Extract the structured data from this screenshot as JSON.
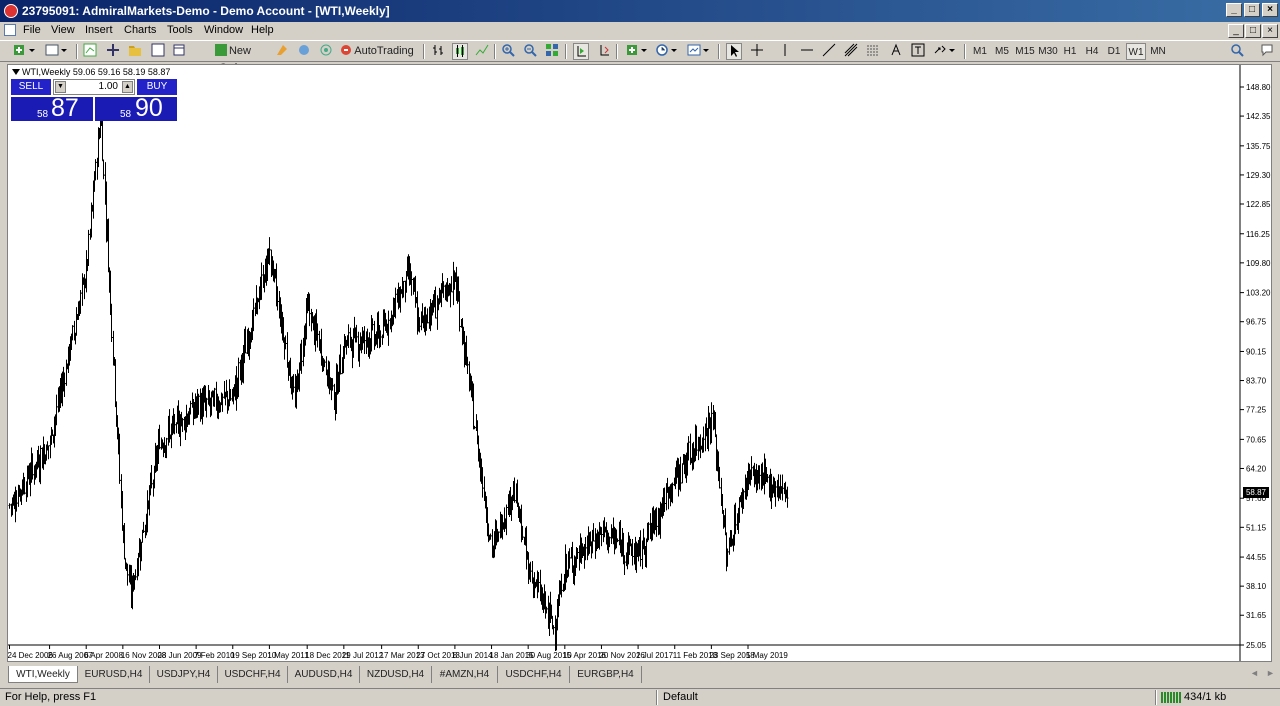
{
  "window": {
    "title": "23795091: AdmiralMarkets-Demo - Demo Account - [WTI,Weekly]"
  },
  "menu": [
    "File",
    "View",
    "Insert",
    "Charts",
    "Tools",
    "Window",
    "Help"
  ],
  "toolbar": {
    "new_order_label": "New Order",
    "autotrading_label": "AutoTrading",
    "timeframes": [
      "M1",
      "M5",
      "M15",
      "M30",
      "H1",
      "H4",
      "D1",
      "W1",
      "MN"
    ],
    "selected_timeframe": "W1"
  },
  "chart": {
    "symbol_line": "WTI,Weekly  59.06 59.16 58.19 58.87",
    "current_price_label": "58.87",
    "trade_panel": {
      "sell_label": "SELL",
      "buy_label": "BUY",
      "volume": "1.00",
      "sell_price_small": "58",
      "sell_price_big": "87",
      "buy_price_small": "58",
      "buy_price_big": "90"
    }
  },
  "chart_data": {
    "type": "ohlc",
    "symbol": "WTI",
    "timeframe": "Weekly",
    "y_ticks": [
      "148.80",
      "142.35",
      "135.75",
      "129.30",
      "122.85",
      "116.25",
      "109.80",
      "103.20",
      "96.75",
      "90.15",
      "83.70",
      "77.25",
      "70.65",
      "64.20",
      "57.60",
      "51.15",
      "44.55",
      "38.10",
      "31.65",
      "25.05"
    ],
    "ylim": [
      25.05,
      148.8
    ],
    "x_ticks": [
      "24 Dec 2006",
      "26 Aug 2007",
      "6 Apr 2008",
      "16 Nov 2008",
      "28 Jun 2009",
      "7 Feb 2010",
      "19 Sep 2010",
      "1 May 2011",
      "18 Dec 2011",
      "29 Jul 2012",
      "17 Mar 2013",
      "27 Oct 2013",
      "8 Jun 2014",
      "18 Jan 2015",
      "30 Aug 2015",
      "10 Apr 2016",
      "20 Nov 2016",
      "2 Jul 2017",
      "11 Feb 2018",
      "23 Sep 2018",
      "5 May 2019"
    ],
    "price_path": [
      [
        "24 Dec 2006",
        56
      ],
      [
        "26 Aug 2007",
        70
      ],
      [
        "6 Apr 2008",
        108
      ],
      [
        "1 Jul 2008",
        143
      ],
      [
        "16 Nov 2008",
        48
      ],
      [
        "1 Jan 2009",
        36
      ],
      [
        "28 Jun 2009",
        70
      ],
      [
        "7 Feb 2010",
        78
      ],
      [
        "19 Sep 2010",
        80
      ],
      [
        "1 May 2011",
        112
      ],
      [
        "1 Oct 2011",
        79
      ],
      [
        "18 Dec 2011",
        100
      ],
      [
        "1 Jun 2012",
        80
      ],
      [
        "29 Jul 2012",
        92
      ],
      [
        "17 Mar 2013",
        94
      ],
      [
        "1 Sep 2013",
        108
      ],
      [
        "27 Oct 2013",
        96
      ],
      [
        "8 Jun 2014",
        106
      ],
      [
        "18 Jan 2015",
        46
      ],
      [
        "1 Jun 2015",
        60
      ],
      [
        "30 Aug 2015",
        42
      ],
      [
        "1 Feb 2016",
        29
      ],
      [
        "10 Apr 2016",
        42
      ],
      [
        "20 Nov 2016",
        50
      ],
      [
        "2 Jul 2017",
        45
      ],
      [
        "11 Feb 2018",
        62
      ],
      [
        "1 Oct 2018",
        75
      ],
      [
        "25 Dec 2018",
        45
      ],
      [
        "5 May 2019",
        63
      ],
      [
        "1 Jan 2020",
        58.87
      ]
    ],
    "grid": false
  },
  "tabs": {
    "items": [
      "WTI,Weekly",
      "EURUSD,H4",
      "USDJPY,H4",
      "USDCHF,H4",
      "AUDUSD,H4",
      "NZDUSD,H4",
      "#AMZN,H4",
      "USDCHF,H4",
      "EURGBP,H4"
    ],
    "active": "WTI,Weekly"
  },
  "status": {
    "help_text": "For Help, press F1",
    "profile": "Default",
    "traffic": "434/1 kb"
  }
}
